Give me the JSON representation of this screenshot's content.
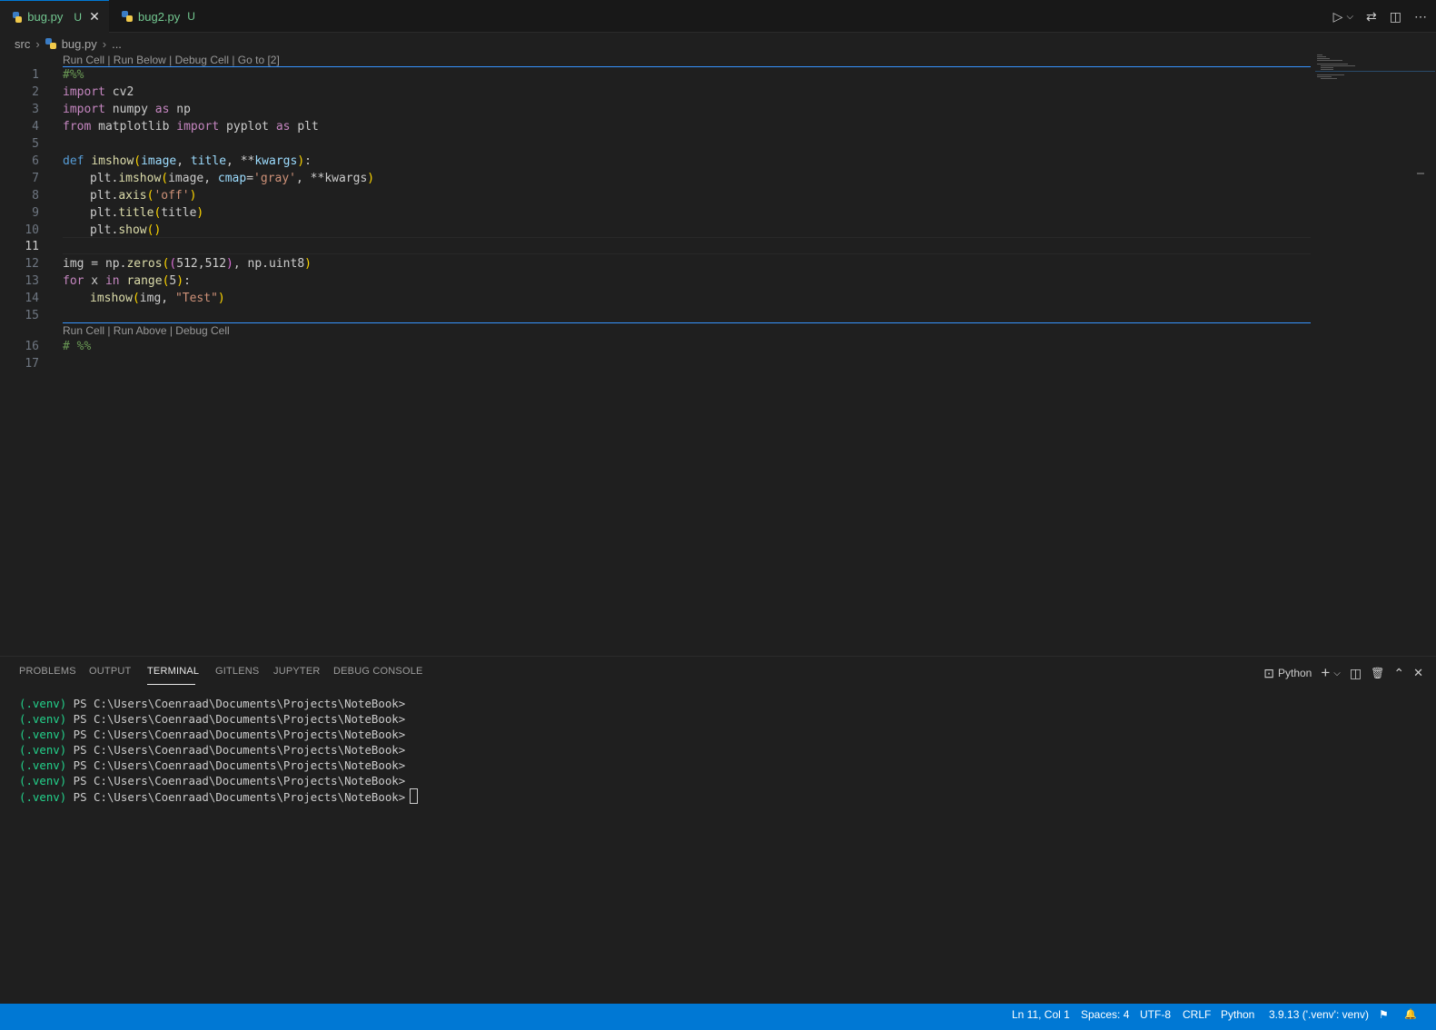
{
  "tabs": [
    {
      "name": "bug.py",
      "badge": "U",
      "close": "✕"
    },
    {
      "name": "bug2.py",
      "badge": "U"
    }
  ],
  "tab_actions": {
    "run": "▷",
    "run_menu": "⌵",
    "compare": "⇄",
    "split": "◫",
    "more": "⋯"
  },
  "breadcrumb": {
    "folder": "src",
    "file": "bug.py",
    "symbol": "..."
  },
  "codelens": {
    "top": "Run Cell | Run Below | Debug Cell | Go to [2]",
    "bottom": "Run Cell | Run Above | Debug Cell"
  },
  "editor": {
    "line_numbers": [
      "1",
      "2",
      "3",
      "4",
      "5",
      "6",
      "7",
      "8",
      "9",
      "10",
      "11",
      "12",
      "13",
      "14",
      "15",
      "16",
      "17"
    ],
    "code": {
      "l1": "#%%",
      "l2_kw": "import",
      "l2_mod": "cv2",
      "l3_kw": "import",
      "l3_mod": "numpy",
      "l3_as": "as",
      "l3_alias": "np",
      "l4_from": "from",
      "l4_mod": "matplotlib",
      "l4_import": "import",
      "l4_name": "pyplot",
      "l4_as": "as",
      "l4_alias": "plt",
      "l6_def": "def",
      "l6_fn": "imshow",
      "l6_open": "(",
      "l6_p1": "image",
      "l6_c1": ", ",
      "l6_p2": "title",
      "l6_c2": ", **",
      "l6_p3": "kwargs",
      "l6_close": ")",
      "l6_colon": ":",
      "l7_obj": "plt.",
      "l7_fn": "imshow",
      "l7_open": "(",
      "l7_a1": "image, ",
      "l7_kw": "cmap",
      "l7_eq": "=",
      "l7_str": "'gray'",
      "l7_rest": ", **kwargs",
      "l7_close": ")",
      "l8_obj": "plt.",
      "l8_fn": "axis",
      "l8_open": "(",
      "l8_str": "'off'",
      "l8_close": ")",
      "l9_obj": "plt.",
      "l9_fn": "title",
      "l9_open": "(",
      "l9_arg": "title",
      "l9_close": ")",
      "l10_obj": "plt.",
      "l10_fn": "show",
      "l10_paren": "()",
      "l12_var": "img",
      "l12_eq": " = np.",
      "l12_fn": "zeros",
      "l12_o1": "(",
      "l12_o2": "(",
      "l12_n1": "512",
      "l12_comma": ",",
      "l12_n2": "512",
      "l12_c2": ")",
      "l12_rest": ", np.uint8",
      "l12_c1": ")",
      "l13_for": "for",
      "l13_x": " x ",
      "l13_in": "in",
      "l13_fn": " range",
      "l13_o": "(",
      "l13_n": "5",
      "l13_c": ")",
      "l13_colon": ":",
      "l14_fn": "imshow",
      "l14_o": "(",
      "l14_arg": "img, ",
      "l14_str": "\"Test\"",
      "l14_c": ")",
      "l16": "# %%"
    }
  },
  "panel": {
    "tabs": [
      "PROBLEMS",
      "OUTPUT",
      "TERMINAL",
      "GITLENS",
      "JUPYTER",
      "DEBUG CONSOLE"
    ],
    "active_tab": "TERMINAL",
    "terminal_profile": "Python",
    "actions": {
      "terminal": "⊡",
      "add": "+",
      "add_menu": "⌵",
      "split": "◫",
      "trash": "🗑",
      "maximize": "⌃",
      "close": "✕"
    },
    "terminal_lines": [
      {
        "venv": "(.venv)",
        "prompt": " PS C:\\Users\\Coenraad\\Documents\\Projects\\NoteBook>"
      },
      {
        "venv": "(.venv)",
        "prompt": " PS C:\\Users\\Coenraad\\Documents\\Projects\\NoteBook>"
      },
      {
        "venv": "(.venv)",
        "prompt": " PS C:\\Users\\Coenraad\\Documents\\Projects\\NoteBook>"
      },
      {
        "venv": "(.venv)",
        "prompt": " PS C:\\Users\\Coenraad\\Documents\\Projects\\NoteBook>"
      },
      {
        "venv": "(.venv)",
        "prompt": " PS C:\\Users\\Coenraad\\Documents\\Projects\\NoteBook>"
      },
      {
        "venv": "(.venv)",
        "prompt": " PS C:\\Users\\Coenraad\\Documents\\Projects\\NoteBook>"
      },
      {
        "venv": "(.venv)",
        "prompt": " PS C:\\Users\\Coenraad\\Documents\\Projects\\NoteBook>"
      }
    ]
  },
  "statusbar": {
    "position": "Ln 11, Col 1",
    "spaces": "Spaces: 4",
    "encoding": "UTF-8",
    "eol": "CRLF",
    "language": "Python",
    "interpreter": "3.9.13 ('.venv': venv)",
    "feedback": "⚑",
    "bell": "🔔"
  },
  "colors": {
    "accent": "#0078d4",
    "modified": "#73c991",
    "venv": "#23d18b"
  }
}
